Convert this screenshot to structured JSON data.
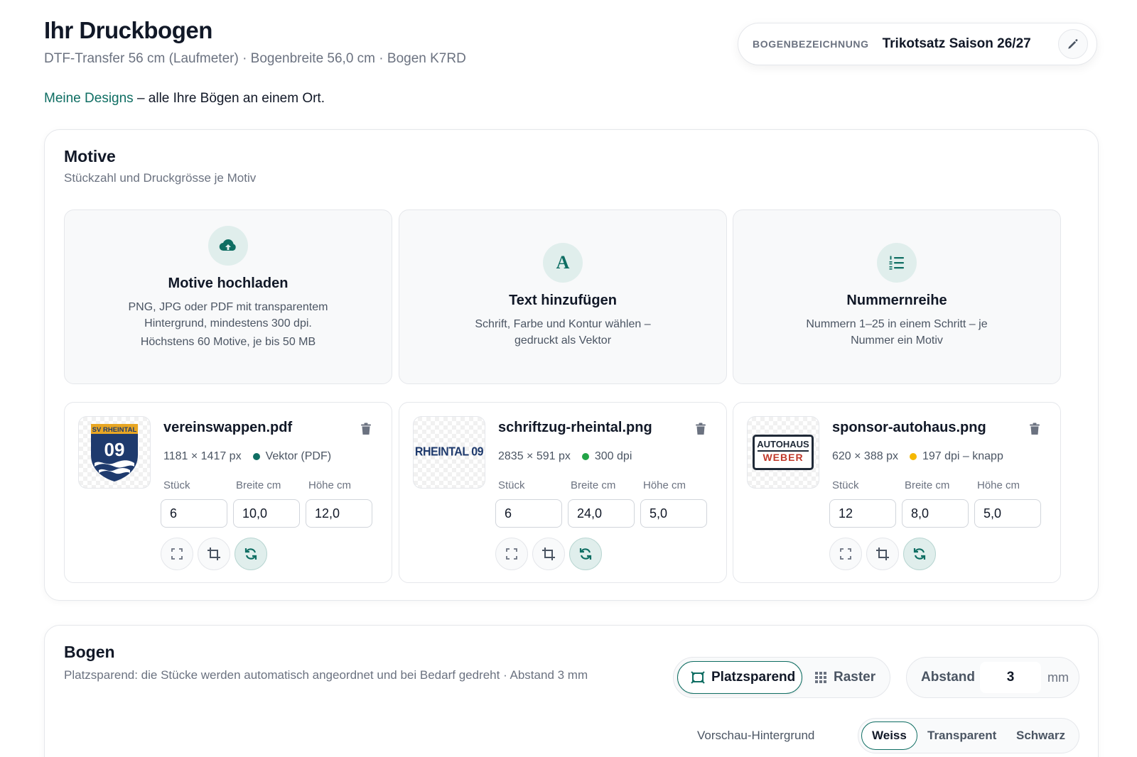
{
  "header": {
    "title": "Ihr Druckbogen",
    "subtitle": "DTF-Transfer 56 cm (Laufmeter) · Bogenbreite 56,0 cm · Bogen K7RD",
    "intro_link": "Meine Designs",
    "intro_text": " – alle Ihre Bögen an einem Ort."
  },
  "sheet_name": {
    "label": "BOGENBEZEICHNUNG",
    "value": "Trikotsatz Saison 26/27",
    "edit_icon": "pencil-icon"
  },
  "motive": {
    "title": "Motive",
    "subtitle": "Stückzahl und Druckgrösse je Motiv",
    "actions": [
      {
        "icon": "cloud-upload-icon",
        "title": "Motive hochladen",
        "desc": "PNG, JPG oder PDF mit transparentem Hintergrund, mindestens 300 dpi.",
        "desc2": "Höchstens 60 Motive, je bis 50 MB"
      },
      {
        "icon": "letter-a-icon",
        "title": "Text hinzufügen",
        "desc": "Schrift, Farbe und Kontur wählen – gedruckt als Vektor",
        "desc2": ""
      },
      {
        "icon": "numbered-list-icon",
        "title": "Nummernreihe",
        "desc": "Nummern 1–25 in einem Schritt – je Nummer ein Motiv",
        "desc2": ""
      }
    ],
    "field_labels": {
      "qty": "Stück",
      "width": "Breite cm",
      "height": "Höhe cm"
    },
    "items": [
      {
        "filename": "vereinswappen.pdf",
        "size": "1181 × 1417 px",
        "quality": "Vektor (PDF)",
        "quality_color": "#0f6e63",
        "qty": "6",
        "width": "10,0",
        "height": "12,0",
        "thumb_text_top": "SV RHEINTAL",
        "thumb_text_main": "09"
      },
      {
        "filename": "schriftzug-rheintal.png",
        "size": "2835 × 591 px",
        "quality": "300 dpi",
        "quality_color": "#22a447",
        "qty": "6",
        "width": "24,0",
        "height": "5,0",
        "thumb_text_main": "RHEINTAL 09"
      },
      {
        "filename": "sponsor-autohaus.png",
        "size": "620 × 388 px",
        "quality": "197 dpi – knapp",
        "quality_color": "#f5b800",
        "qty": "12",
        "width": "8,0",
        "height": "5,0",
        "thumb_text_top": "AUTOHAUS",
        "thumb_text_main": "WEBER"
      }
    ]
  },
  "bogen": {
    "title": "Bogen",
    "subtitle": "Platzsparend: die Stücke werden automatisch angeordnet und bei Bedarf gedreht · Abstand 3 mm",
    "layout_options": [
      "Platzsparend",
      "Raster"
    ],
    "layout_selected": "Platzsparend",
    "gap_label": "Abstand",
    "gap_value": "3",
    "gap_unit": "mm",
    "bg_label": "Vorschau-Hintergrund",
    "bg_options": [
      "Weiss",
      "Transparent",
      "Schwarz"
    ],
    "bg_selected": "Weiss"
  },
  "colors": {
    "accent": "#0f6e63",
    "accent_light": "#e0eeec"
  }
}
